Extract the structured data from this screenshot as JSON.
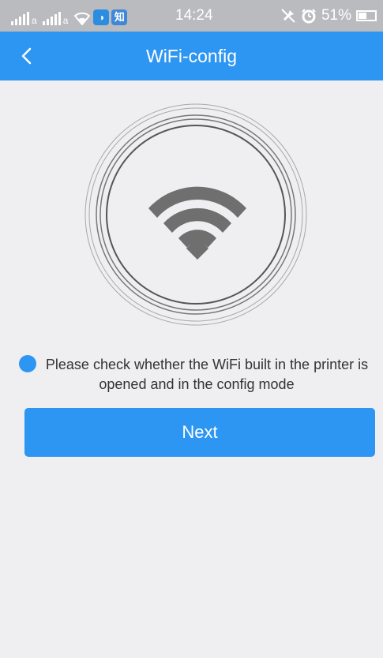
{
  "status_bar": {
    "network_letter_1": "a",
    "network_letter_2": "a",
    "app_icon_1": "◑",
    "app_icon_2": "知",
    "time": "14:24",
    "battery_percent": "51%",
    "battery_level": 0.51,
    "icons": [
      "signal-icon",
      "wifi-icon",
      "mute-icon",
      "alarm-icon",
      "battery-icon"
    ]
  },
  "nav": {
    "title": "WiFi-config",
    "back_icon": "chevron-left-icon"
  },
  "illustration": {
    "icon": "wifi-icon"
  },
  "hint": {
    "text": "Please check whether the WiFi built in the printer is opened and in the config mode"
  },
  "actions": {
    "next_label": "Next"
  },
  "colors": {
    "accent": "#2d95f2",
    "status_bar": "#b9bbbf",
    "background": "#efeff1",
    "wifi_icon": "#6f6f6f"
  }
}
